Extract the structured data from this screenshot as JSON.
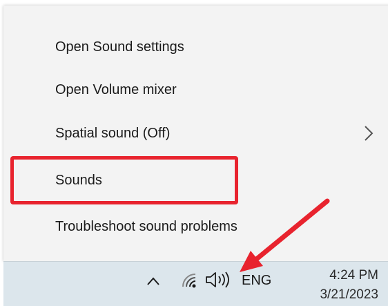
{
  "menu": {
    "items": [
      {
        "label": "Open Sound settings"
      },
      {
        "label": "Open Volume mixer"
      },
      {
        "label": "Spatial sound (Off)"
      },
      {
        "label": "Sounds"
      },
      {
        "label": "Troubleshoot sound problems"
      }
    ]
  },
  "taskbar": {
    "language": "ENG",
    "time": "4:24 PM",
    "date": "3/21/2023"
  },
  "colors": {
    "highlight": "#e8232e",
    "arrow": "#e8232e",
    "menu_bg": "#f3f3f3",
    "taskbar_bg": "#dce6ec"
  },
  "icons": [
    "chevron-right-icon",
    "chevron-up-icon",
    "wifi-icon",
    "speaker-icon",
    "red-pointer-arrow-icon"
  ]
}
